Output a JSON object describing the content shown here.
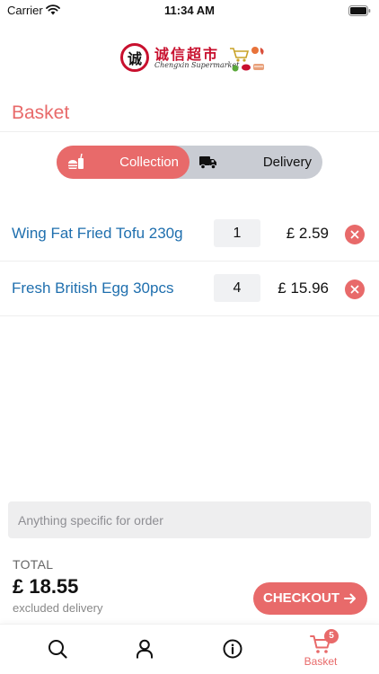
{
  "status_bar": {
    "carrier": "Carrier",
    "time": "11:34 AM",
    "wifi_icon": "wifi-icon",
    "battery_icon": "battery-icon"
  },
  "logo": {
    "chinese_text": "诚信超市",
    "badge_character": "诚",
    "english_text": "Chengxin Supermarket",
    "brand_color": "#c8102e"
  },
  "page": {
    "title": "Basket"
  },
  "mode_toggle": {
    "collection_label": "Collection",
    "collection_icon": "food-drink-icon",
    "delivery_label": "Delivery",
    "delivery_icon": "delivery-truck-icon",
    "selected": "Collection"
  },
  "items": [
    {
      "name": "Wing Fat Fried Tofu 230g",
      "quantity": "1",
      "price": "£ 2.59"
    },
    {
      "name": "Fresh British Egg 30pcs",
      "quantity": "4",
      "price": "£ 15.96"
    }
  ],
  "order_note": {
    "placeholder": "Anything specific for order",
    "value": ""
  },
  "summary": {
    "total_label": "TOTAL",
    "total_amount": "£ 18.55",
    "total_note": "excluded delivery"
  },
  "checkout": {
    "label": "CHECKOUT",
    "icon": "arrow-right-icon"
  },
  "tab_bar": {
    "items": [
      {
        "icon": "search-icon",
        "label": ""
      },
      {
        "icon": "user-icon",
        "label": ""
      },
      {
        "icon": "info-icon",
        "label": ""
      },
      {
        "icon": "cart-icon",
        "label": "Basket",
        "badge": "5",
        "active": true
      }
    ]
  },
  "colors": {
    "accent": "#e86a6a",
    "link": "#1f6fae",
    "toggle_inactive": "#c9ccd3"
  }
}
